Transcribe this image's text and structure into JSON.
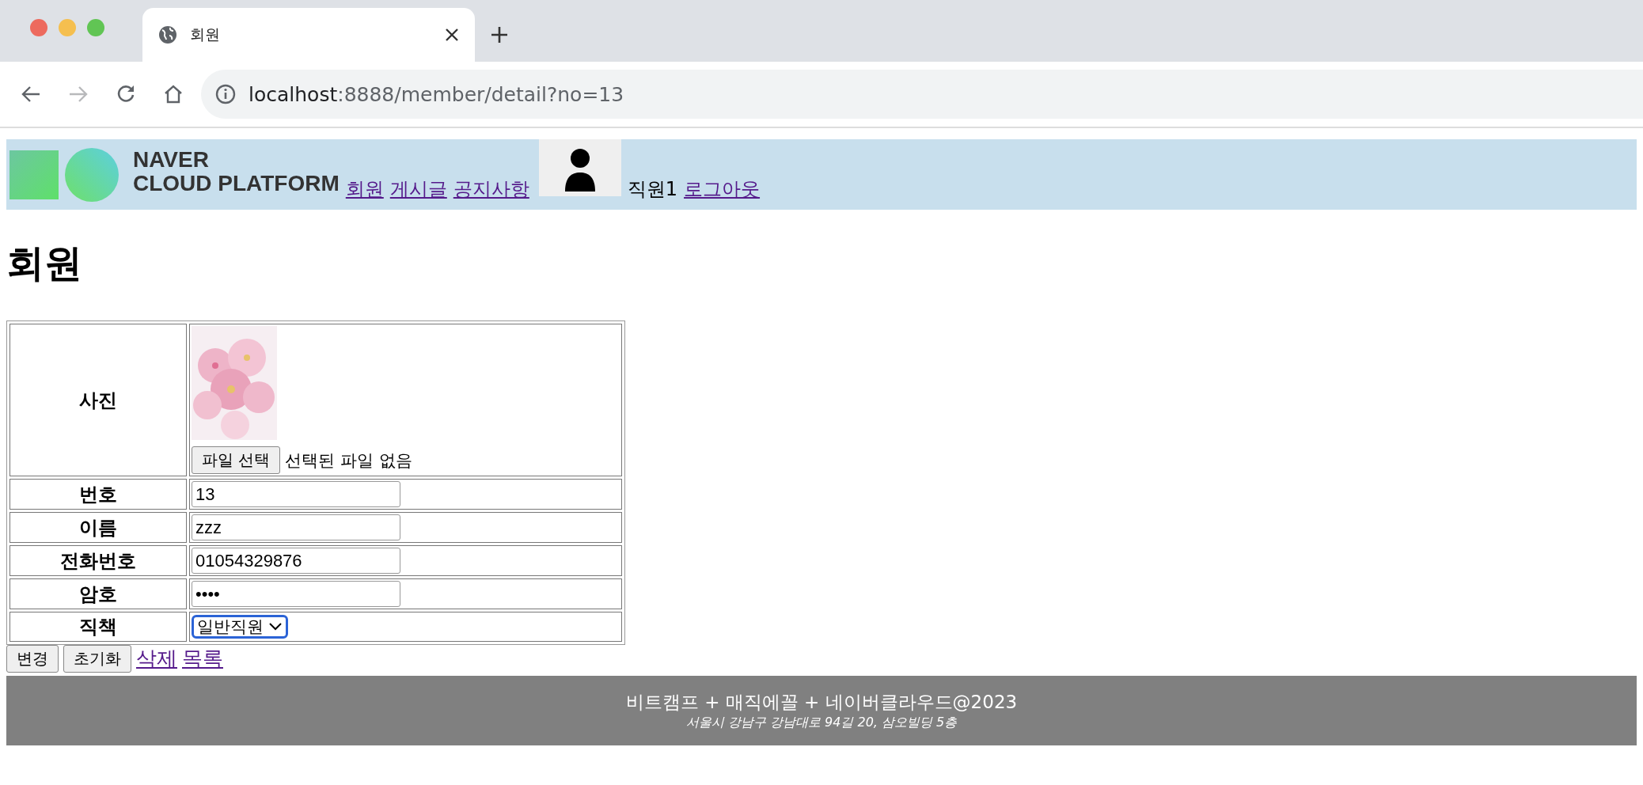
{
  "browser": {
    "tab_title": "회원",
    "url_host": "localhost",
    "url_path": ":8888/member/detail?no=13",
    "forward_disabled": true
  },
  "header": {
    "logo_lines": [
      "NAVER",
      "CLOUD PLATFORM"
    ],
    "nav": [
      "회원",
      "게시글",
      "공지사항"
    ],
    "user_name": "직원1",
    "logout": "로그아웃"
  },
  "title": "회원",
  "form": [
    {
      "label": "사진",
      "button": "파일 선택",
      "status": "선택된 파일 없음"
    },
    {
      "kind": "text",
      "label": "번호",
      "value": "13"
    },
    {
      "kind": "text",
      "label": "이름",
      "value": "zzz"
    },
    {
      "kind": "text",
      "label": "전화번호",
      "value": "01054329876"
    },
    {
      "kind": "password",
      "label": "암호",
      "value": "••••"
    },
    {
      "kind": "select",
      "label": "직책",
      "value": "일반직원"
    }
  ],
  "actions": [
    {
      "kind": "button",
      "label": "변경"
    },
    {
      "kind": "button",
      "label": "초기화"
    },
    {
      "kind": "link",
      "label": "삭제"
    },
    {
      "kind": "link",
      "label": "목록"
    }
  ],
  "footer": {
    "line1": "비트캠프 + 매직에꼴 + 네이버클라우드@2023",
    "line2": "서울시 강남구 강남대로 94길 20, 삼오빌딩 5층"
  }
}
